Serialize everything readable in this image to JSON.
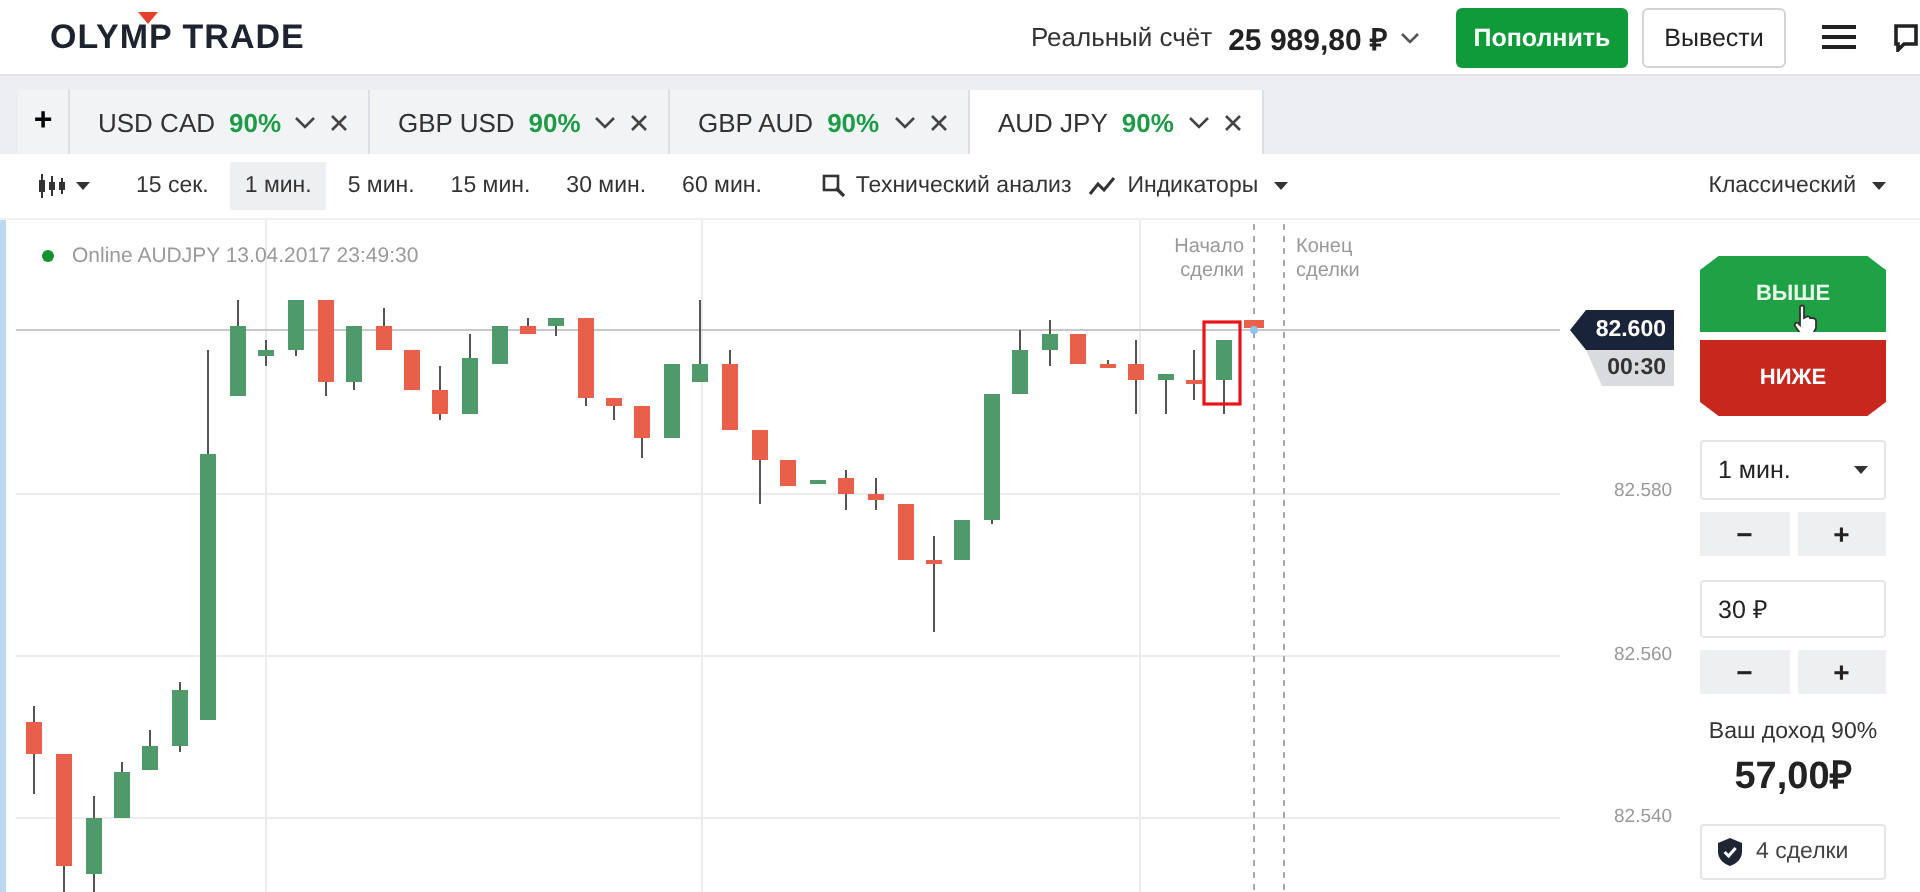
{
  "header": {
    "logo": "OLYMP TRADE",
    "account_label": "Реальный счёт",
    "balance": "25 989,80 ₽",
    "deposit_button": "Пополнить",
    "withdraw_button": "Вывести"
  },
  "add_tab": "+",
  "tabs": [
    {
      "pair": "USD CAD",
      "payout": "90%",
      "selected": false
    },
    {
      "pair": "GBP USD",
      "payout": "90%",
      "selected": false
    },
    {
      "pair": "GBP AUD",
      "payout": "90%",
      "selected": false
    },
    {
      "pair": "AUD JPY",
      "payout": "90%",
      "selected": true
    }
  ],
  "toolbar": {
    "periods": [
      {
        "label": "15 сек.",
        "selected": false
      },
      {
        "label": "1 мин.",
        "selected": true
      },
      {
        "label": "5 мин.",
        "selected": false
      },
      {
        "label": "15 мин.",
        "selected": false
      },
      {
        "label": "30 мин.",
        "selected": false
      },
      {
        "label": "60 мин.",
        "selected": false
      }
    ],
    "analysis": "Технический анализ",
    "indicators": "Индикаторы",
    "chart_style": "Классический"
  },
  "chart": {
    "status": "Online AUDJPY 13.04.2017 23:49:30",
    "online": true,
    "trade_start": "Начало сделки",
    "trade_end": "Конец сделки",
    "current_price": "82.600",
    "timer": "00:30",
    "price_labels": [
      "82.580",
      "82.560",
      "82.540"
    ]
  },
  "trade_panel": {
    "up_button": "ВЫШЕ",
    "down_button": "НИЖЕ",
    "duration": "1 мин.",
    "duration_steppers": [
      "−",
      "+"
    ],
    "amount": "30 ₽",
    "amount_steppers": [
      "−",
      "+"
    ],
    "income_label": "Ваш доход 90%",
    "income": "57,00₽",
    "trades_button": "4 сделки"
  }
}
